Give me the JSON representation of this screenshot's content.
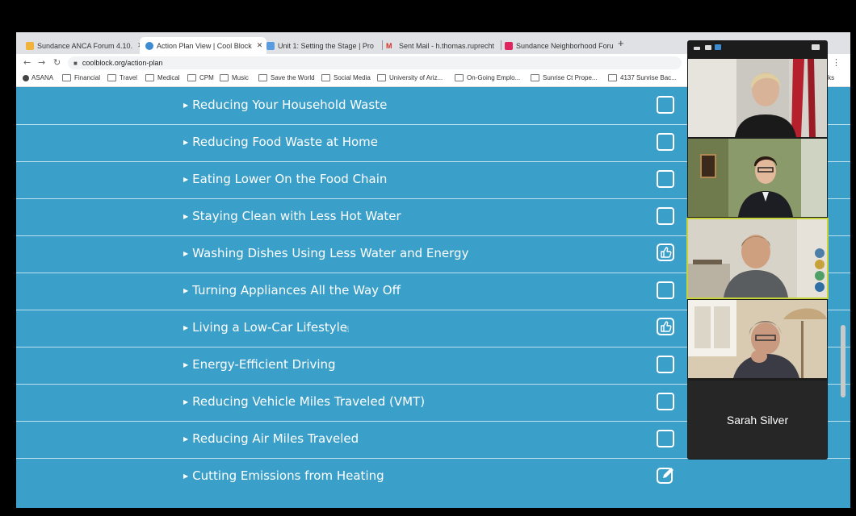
{
  "browser": {
    "tabs": [
      {
        "label": "Sundance ANCA Forum 4.10.",
        "favicon_color": "#f2b33d",
        "active": false
      },
      {
        "label": "Action Plan View | Cool Block",
        "favicon_color": "#3d8bd1",
        "active": true
      },
      {
        "label": "Unit 1: Setting the Stage | Pro",
        "favicon_color": "#5a9be0",
        "active": false
      },
      {
        "label": "Sent Mail - h.thomas.ruprecht",
        "favicon_color": "#d93025",
        "active": false
      },
      {
        "label": "Sundance Neighborhood Foru",
        "favicon_color": "#e0245e",
        "active": false
      }
    ],
    "new_tab": "+",
    "url": "coolblock.org/action-plan",
    "bookmarks": [
      "ASANA",
      "Financial",
      "Travel",
      "Medical",
      "CPM",
      "Music",
      "Save the World",
      "Social Media",
      "University of Ariz...",
      "On-Going Emplo...",
      "Sunrise Ct Prope...",
      "4137 Sunrise Bac..."
    ],
    "bookmarks_overflow": "arks"
  },
  "action_plan": {
    "items": [
      {
        "label": "Reducing Your Household Waste",
        "status": "unchecked"
      },
      {
        "label": "Reducing Food Waste at Home",
        "status": "unchecked"
      },
      {
        "label": "Eating Lower On the Food Chain",
        "status": "unchecked"
      },
      {
        "label": "Staying Clean with Less Hot Water",
        "status": "unchecked"
      },
      {
        "label": "Washing Dishes Using Less Water and Energy",
        "status": "thumbs-up"
      },
      {
        "label": "Turning Appliances All the Way Off",
        "status": "unchecked"
      },
      {
        "label": "Living a Low-Car Lifestyle",
        "status": "thumbs-up"
      },
      {
        "label": "Energy-Efficient Driving",
        "status": "unchecked"
      },
      {
        "label": "Reducing Vehicle Miles Traveled (VMT)",
        "status": "unchecked"
      },
      {
        "label": "Reducing Air Miles Traveled",
        "status": "unchecked"
      },
      {
        "label": "Cutting Emissions from Heating",
        "status": "edit"
      }
    ]
  },
  "video_call": {
    "participants": [
      {
        "name_shown": false,
        "speaking": false
      },
      {
        "name_shown": false,
        "speaking": false
      },
      {
        "name_shown": false,
        "speaking": true
      },
      {
        "name_shown": false,
        "speaking": false
      }
    ],
    "name_tile": "Sarah Silver",
    "speaking_color": "#c7d33b"
  },
  "colors": {
    "content_background": "#3a9fc9",
    "row_divider": "#bde0ef"
  }
}
